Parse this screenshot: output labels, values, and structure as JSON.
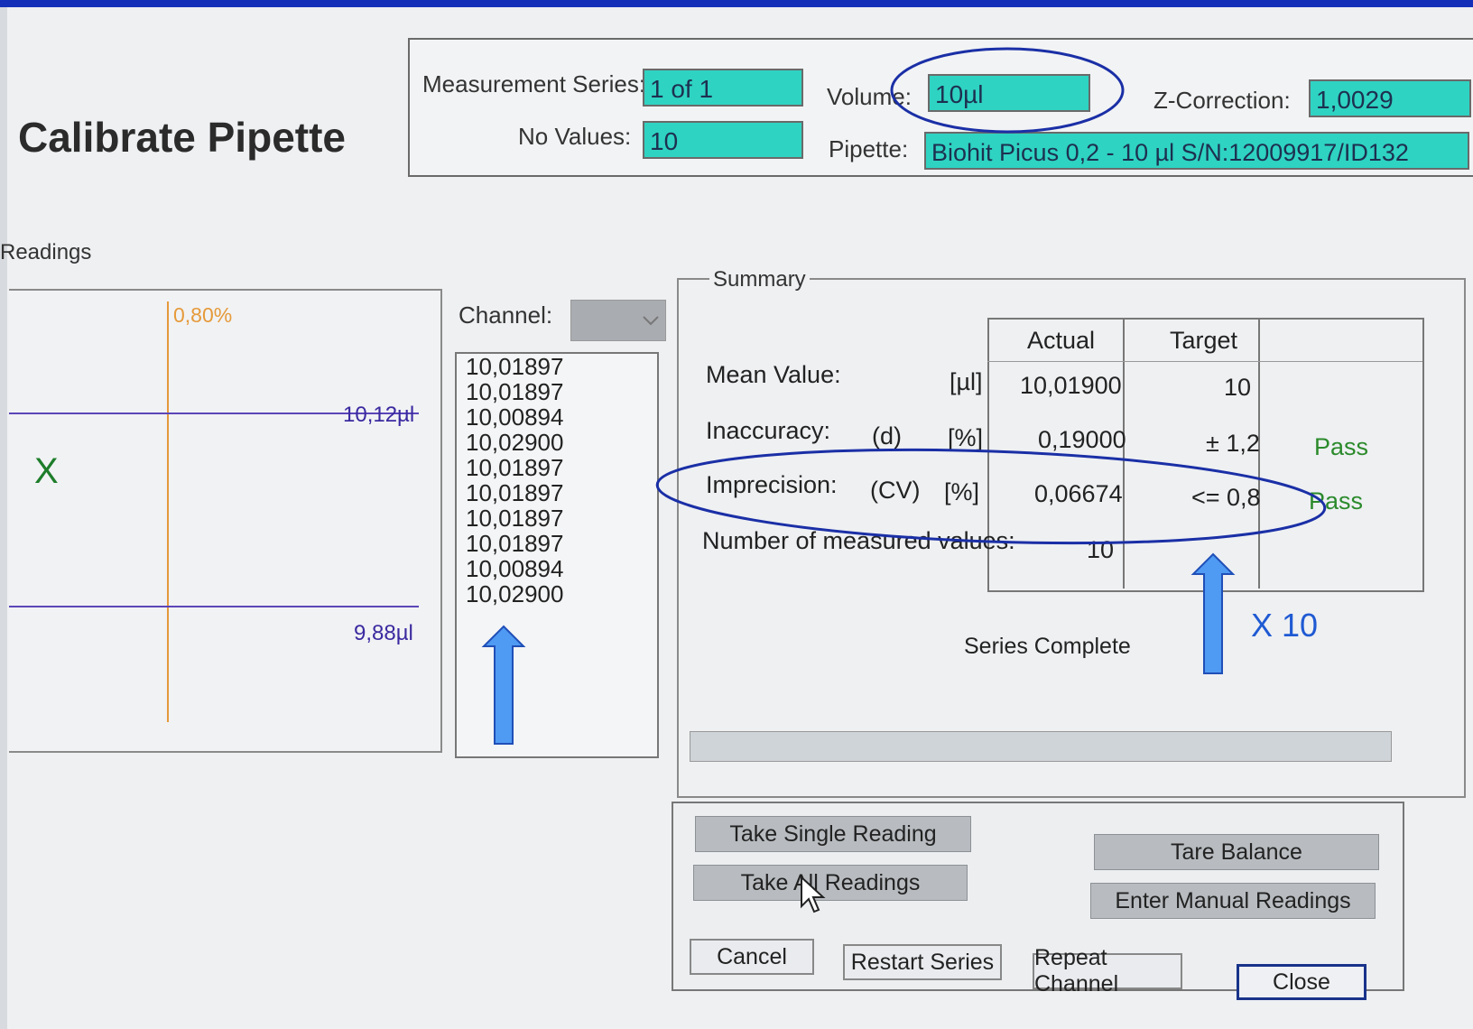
{
  "page_title": "Calibrate Pipette",
  "header": {
    "measurement_series_label": "Measurement Series:",
    "measurement_series_value": "1 of 1",
    "no_values_label": "No Values:",
    "no_values_value": "10",
    "volume_label": "Volume:",
    "volume_value": "10µl",
    "z_correction_label": "Z-Correction:",
    "z_correction_value": "1,0029",
    "pipette_label": "Pipette:",
    "pipette_value": "Biohit Picus 0,2 - 10 µl S/N:12009917/ID132"
  },
  "readings_group": {
    "label": "Readings",
    "x_marker": "X",
    "graph": {
      "tolerance_label": "0,80%",
      "upper_limit_label": "10,12µl",
      "lower_limit_label": "9,88µl"
    },
    "channel_label": "Channel:",
    "values": [
      "10,01897",
      "10,01897",
      "10,00894",
      "10,02900",
      "10,01897",
      "10,01897",
      "10,01897",
      "10,01897",
      "10,00894",
      "10,02900"
    ]
  },
  "summary": {
    "label": "Summary",
    "columns": {
      "actual": "Actual",
      "target": "Target"
    },
    "rows": {
      "mean": {
        "label": "Mean Value:",
        "symbol": "",
        "unit": "[µl]",
        "actual": "10,01900",
        "target": "10",
        "result": ""
      },
      "inaccuracy": {
        "label": "Inaccuracy:",
        "symbol": "(d)",
        "unit": "[%]",
        "actual": "0,19000",
        "target": "± 1,2",
        "result": "Pass"
      },
      "imprecision": {
        "label": "Imprecision:",
        "symbol": "(CV)",
        "unit": "[%]",
        "actual": "0,06674",
        "target": "<= 0,8",
        "result": "Pass"
      },
      "count": {
        "label": "Number of measured values:",
        "actual": "10"
      }
    },
    "status": "Series Complete"
  },
  "buttons": {
    "take_single": "Take Single Reading",
    "take_all": "Take All Readings",
    "tare": "Tare Balance",
    "manual": "Enter Manual Readings",
    "cancel": "Cancel",
    "restart": "Restart Series",
    "repeat": "Repeat Channel",
    "close": "Close"
  },
  "annotation": {
    "multiplier": "X 10",
    "color": "#1f5ad3"
  }
}
